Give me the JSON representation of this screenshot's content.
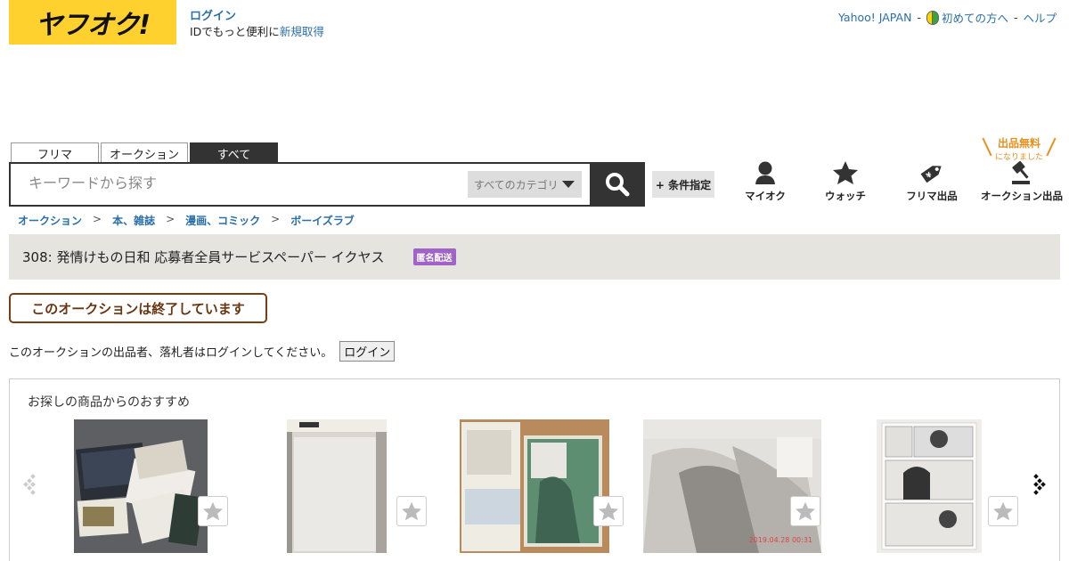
{
  "header": {
    "logo_text": "ヤフオク!",
    "login_link": "ログイン",
    "login_sub_text": "IDでもっと便利に",
    "register_link": "新規取得",
    "yahoo_japan": "Yahoo! JAPAN",
    "beginner": "初めての方へ",
    "help": "ヘルプ",
    "sep": "-"
  },
  "search": {
    "tabs": [
      "フリマ",
      "オークション",
      "すべて"
    ],
    "placeholder": "キーワードから探す",
    "category": "すべてのカテゴリ",
    "condition_button": "+ 条件指定"
  },
  "nav": {
    "myauc": "マイオク",
    "watch": "ウォッチ",
    "flea_sell": "フリマ出品",
    "auction_sell": "オークション出品",
    "free_badge_1": "出品無料",
    "free_badge_2": "になりました"
  },
  "breadcrumb": [
    "オークション",
    "本、雑誌",
    "漫画、コミック",
    "ボーイズラブ"
  ],
  "breadcrumb_sep": ">",
  "item": {
    "title": "308: 発情けもの日和 応募者全員サービスペーパー イクヤス",
    "badge": "匿名配送",
    "ended": "このオークションは終了しています",
    "login_message": "このオークションの出品者、落札者はログインしてください。",
    "login_button": "ログイン"
  },
  "recommend": {
    "title": "お探しの商品からのおすすめ",
    "thumb_texts": [
      "2019.04.28 00:31"
    ]
  },
  "colors": {
    "accent": "#ffd12e",
    "link": "#2a6fa8",
    "ended_border": "#7a3e14",
    "badge": "#a064c8"
  }
}
